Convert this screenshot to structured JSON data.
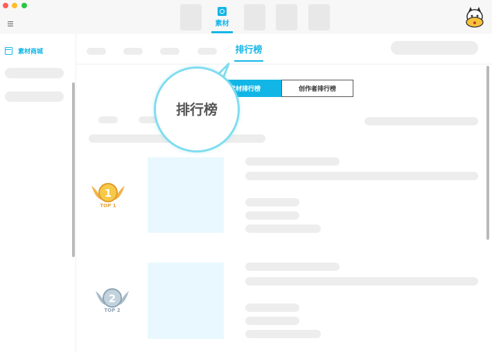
{
  "toolbar": {
    "active_tab_label": "素材"
  },
  "sidebar": {
    "items": [
      {
        "label": "素材商城"
      }
    ]
  },
  "nav": {
    "active_tab_label": "排行榜"
  },
  "ranking_toggle": {
    "options": [
      "素材排行榜",
      "创作者排行榜"
    ],
    "selected": "素材排行榜"
  },
  "callout": {
    "text": "排行榜"
  },
  "rank_list": [
    {
      "rank": "1",
      "badge": "TOP 1",
      "badge_color": "#e9a23b"
    },
    {
      "rank": "2",
      "badge": "TOP 2",
      "badge_color": "#8fa3b3"
    }
  ],
  "colors": {
    "accent": "#12b6e6",
    "placeholder": "#ededed",
    "thumbnail": "#e8f8fe"
  },
  "icons": [
    "menu-icon",
    "material-icon",
    "mascot-avatar-icon",
    "store-icon",
    "medal-gold-icon",
    "medal-silver-icon"
  ]
}
